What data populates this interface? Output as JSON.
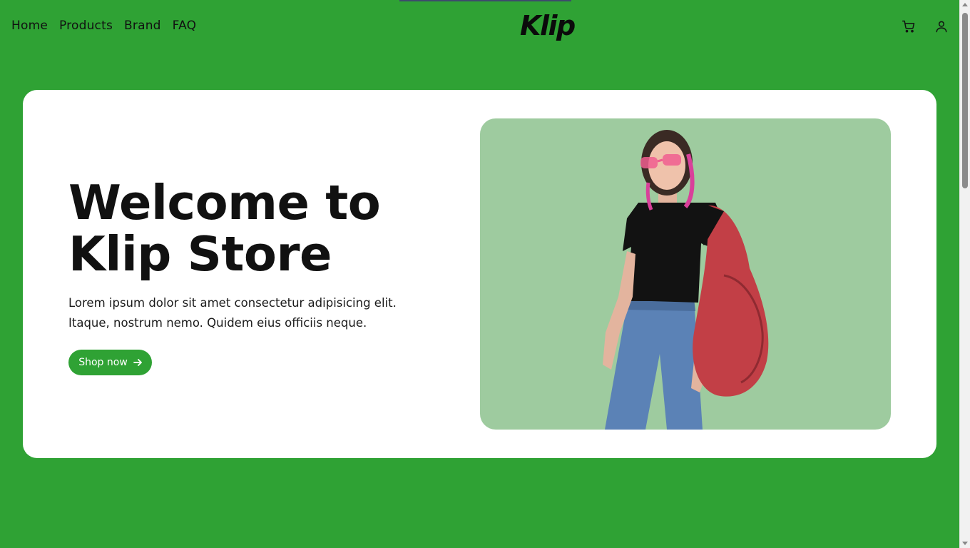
{
  "nav": {
    "items": [
      {
        "label": "Home"
      },
      {
        "label": "Products"
      },
      {
        "label": "Brand"
      },
      {
        "label": "FAQ"
      }
    ]
  },
  "logo": {
    "text": "Klip"
  },
  "header_icons": [
    "cart-icon",
    "user-icon"
  ],
  "hero": {
    "title": "Welcome to Klip Store",
    "text": "Lorem ipsum dolor sit amet consectetur adipisicing elit. Itaque, nostrum nemo. Quidem eius officiis neque.",
    "button_label": "Shop now",
    "button_icon": "arrow-right-icon"
  },
  "colors": {
    "brand_green": "#2fa234",
    "card_bg": "#ffffff",
    "image_bg": "#9ecb9f",
    "text_dark": "#111111"
  }
}
